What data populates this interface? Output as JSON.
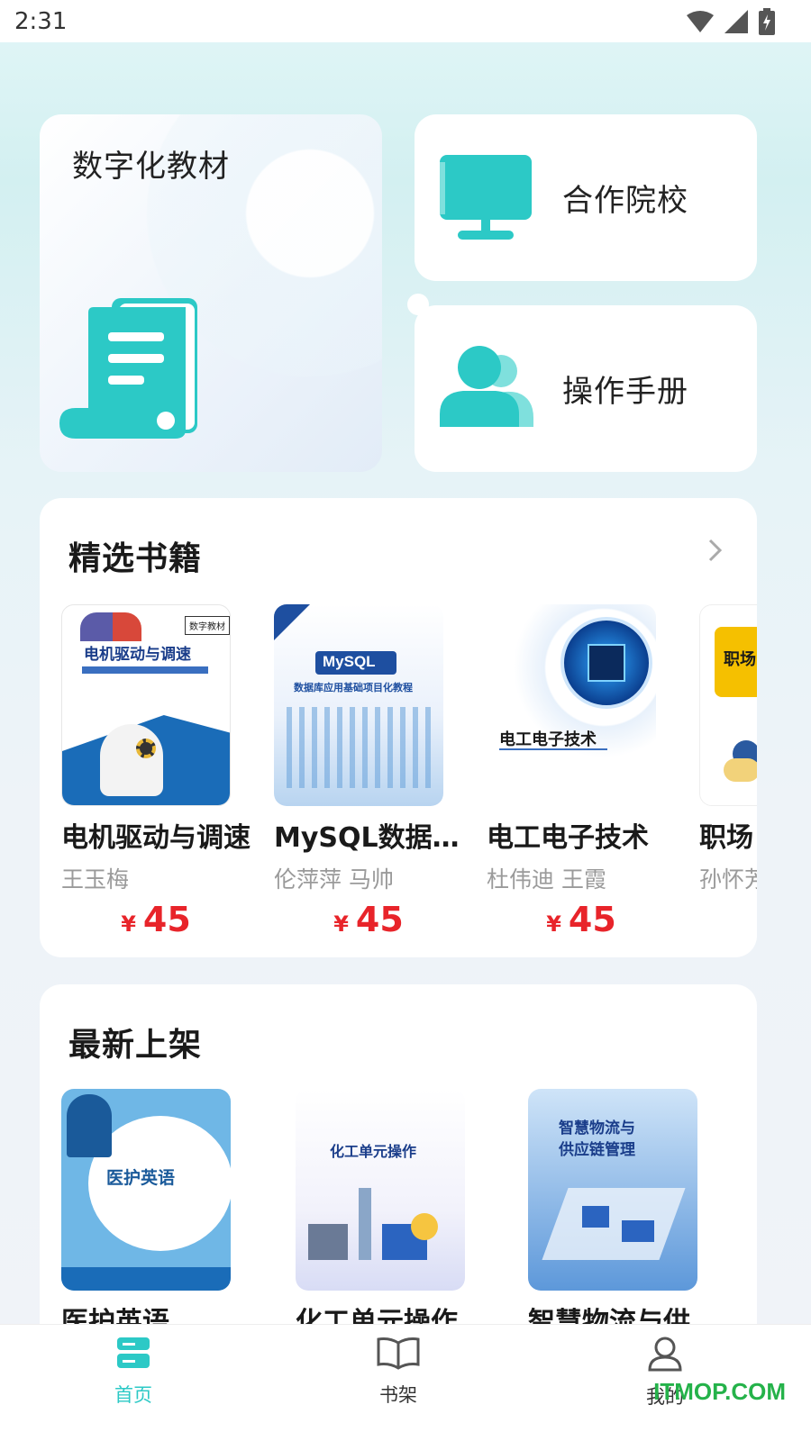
{
  "status_bar": {
    "time": "2:31"
  },
  "quick_cards": {
    "digital": "数字化教材",
    "partner": "合作院校",
    "manual": "操作手册"
  },
  "featured": {
    "title": "精选书籍",
    "books": [
      {
        "title": "电机驱动与调速",
        "author": "王玉梅",
        "currency": "¥",
        "price": "45",
        "cover_title": "电机驱动与调速",
        "badge": "数字教材"
      },
      {
        "title": "MySQL数据库应用基础项目化教程",
        "author": "伦萍萍 马帅",
        "currency": "¥",
        "price": "45",
        "cover_title": "MySQL",
        "cover_subtitle": "数据库应用基础项目化教程"
      },
      {
        "title": "电工电子技术",
        "author": "杜伟迪 王霞",
        "currency": "¥",
        "price": "45",
        "cover_title": "电工电子技术"
      },
      {
        "title": "职场",
        "author": "孙怀芳",
        "cover_title": "职场"
      }
    ]
  },
  "newest": {
    "title": "最新上架",
    "books": [
      {
        "title": "医护英语",
        "cover_title": "医护英语"
      },
      {
        "title": "化工单元操作",
        "cover_title": "化工单元操作"
      },
      {
        "title": "智慧物流与供应链管理",
        "cover_title": "智慧物流与\n供应链管理"
      }
    ]
  },
  "bottom_nav": {
    "home": "首页",
    "shelf": "书架",
    "mine": "我的"
  },
  "watermark": "ITMOP.COM",
  "colors": {
    "teal": "#2cc9c6",
    "price_red": "#e8242a",
    "active_tab": "#2cc9c6"
  }
}
